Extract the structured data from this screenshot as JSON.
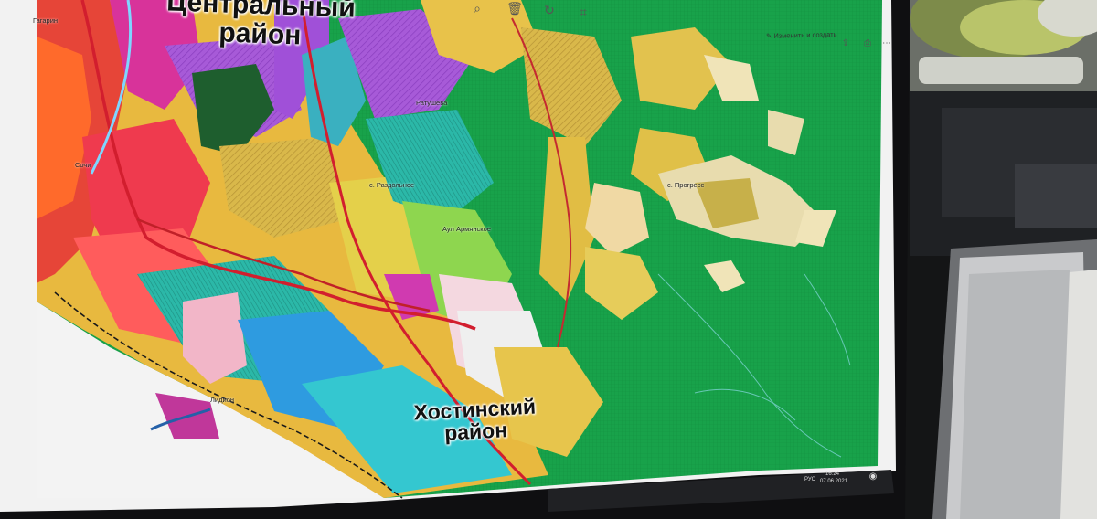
{
  "toolbar": {
    "edit_label": "Изменить и создать",
    "icons": [
      "zoom-icon",
      "delete-icon",
      "rotate-icon",
      "crop-icon",
      "share-icon",
      "print-icon",
      "more-icon"
    ]
  },
  "districts": {
    "central": {
      "line1": "Центральный",
      "line2": "район"
    },
    "khosta": {
      "line1": "Хостинский",
      "line2": "район"
    }
  },
  "places": {
    "gagarin": "Гагарин",
    "sochi": "Сочи",
    "razdolnoe": "с. Раздольное",
    "armianskoe": "Аул Армянское",
    "progress": "с. Прогресс",
    "ratusheva": "Ратушева",
    "station": "Лидион"
  },
  "taskbar": {
    "lang": "РУС",
    "time": "16:24",
    "date": "07.06.2021"
  },
  "colors": {
    "forest": "#1aa64f",
    "residential": "#e6c45a",
    "industrial": "#a64fd6",
    "commercial": "#ee3a5a",
    "water": "#2fc7d6",
    "road": "#d21e2e"
  }
}
